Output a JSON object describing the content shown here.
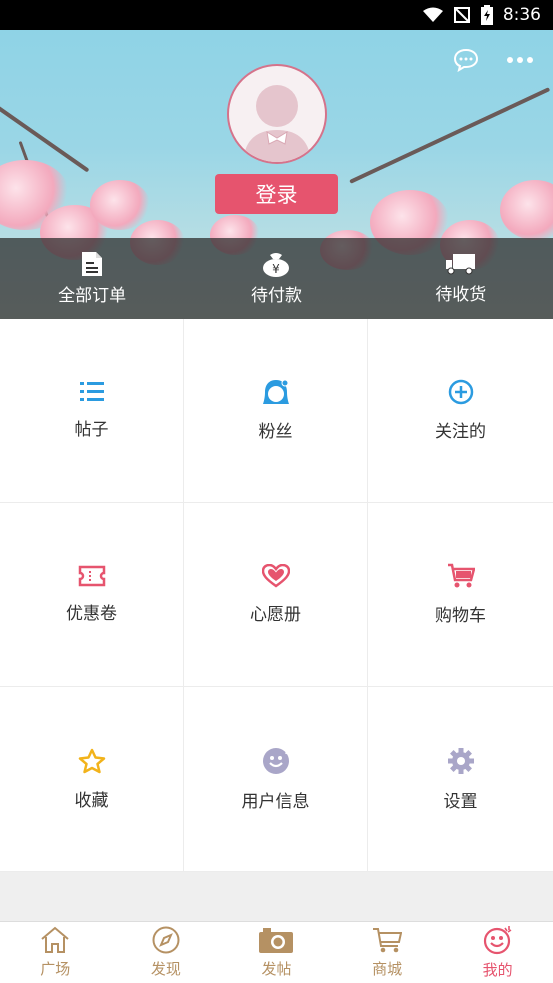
{
  "status_bar": {
    "time": "8:36"
  },
  "header": {
    "login_label": "登录",
    "orders": [
      {
        "label": "全部订单",
        "icon": "document-icon"
      },
      {
        "label": "待付款",
        "icon": "money-bag-icon"
      },
      {
        "label": "待收货",
        "icon": "truck-icon"
      }
    ]
  },
  "grid": [
    {
      "label": "帖子",
      "icon": "list-icon",
      "color": "#2b9be0"
    },
    {
      "label": "粉丝",
      "icon": "fans-icon",
      "color": "#2b9be0"
    },
    {
      "label": "关注的",
      "icon": "plus-circle-icon",
      "color": "#2b9be0"
    },
    {
      "label": "优惠卷",
      "icon": "coupon-icon",
      "color": "#e6546e"
    },
    {
      "label": "心愿册",
      "icon": "heart-icon",
      "color": "#e6546e"
    },
    {
      "label": "购物车",
      "icon": "cart-icon",
      "color": "#e6546e"
    },
    {
      "label": "收藏",
      "icon": "star-icon",
      "color": "#f2b31b"
    },
    {
      "label": "用户信息",
      "icon": "smiley-icon",
      "color": "#a9a6c8"
    },
    {
      "label": "设置",
      "icon": "gear-icon",
      "color": "#a9a6c8"
    }
  ],
  "tabbar": [
    {
      "label": "广场",
      "icon": "home-icon"
    },
    {
      "label": "发现",
      "icon": "compass-icon"
    },
    {
      "label": "发帖",
      "icon": "camera-icon"
    },
    {
      "label": "商城",
      "icon": "basket-icon"
    },
    {
      "label": "我的",
      "icon": "smiley-face-icon",
      "active": true
    }
  ],
  "colors": {
    "accent": "#e6546e",
    "tab": "#b59163",
    "blue": "#2b9be0"
  }
}
